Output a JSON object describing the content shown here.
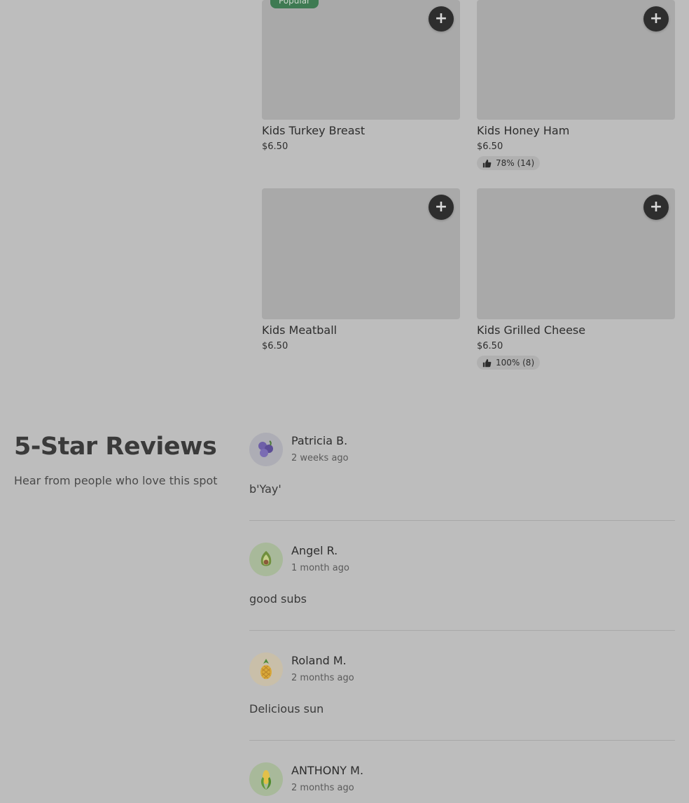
{
  "menu": {
    "items": [
      {
        "name": "Kids Turkey Breast",
        "price": "$6.50",
        "badge": "Popular",
        "rating": null
      },
      {
        "name": "Kids Honey Ham",
        "price": "$6.50",
        "badge": null,
        "rating": "78% (14)"
      },
      {
        "name": "Kids Meatball",
        "price": "$6.50",
        "badge": null,
        "rating": null
      },
      {
        "name": "Kids Grilled Cheese",
        "price": "$6.50",
        "badge": null,
        "rating": "100% (8)"
      }
    ],
    "add_symbol": "+"
  },
  "reviews": {
    "title": "5-Star Reviews",
    "subtitle": "Hear from people who love this spot",
    "list": [
      {
        "name": "Patricia B.",
        "time": "2 weeks ago",
        "text": "b'Yay'",
        "avatar_icon": "blueberry-icon"
      },
      {
        "name": "Angel R.",
        "time": "1 month ago",
        "text": "good subs",
        "avatar_icon": "avocado-icon"
      },
      {
        "name": "Roland M.",
        "time": "2 months ago",
        "text": "Delicious sun",
        "avatar_icon": "pineapple-icon"
      },
      {
        "name": "ANTHONY M.",
        "time": "2 months ago",
        "text": "",
        "avatar_icon": "corn-icon"
      }
    ]
  },
  "colors": {
    "background": "#bdbdbd",
    "image_placeholder": "#a9a9a9",
    "badge_green": "#3e7a52",
    "add_button": "#2e2e2e"
  }
}
